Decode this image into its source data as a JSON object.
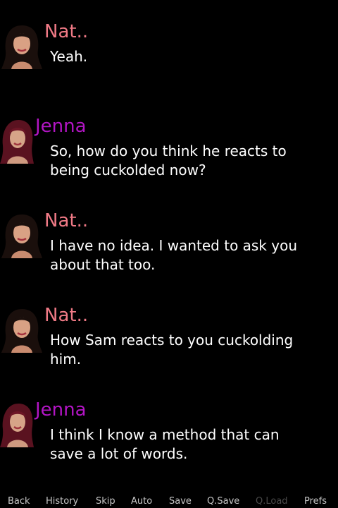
{
  "colors": {
    "nat_name": "#f07a86",
    "jenna_name": "#b215c4",
    "dialogue_text": "#ffffff",
    "menu_text": "#c8c8c8",
    "menu_disabled": "#4a4a4a"
  },
  "history": [
    {
      "speaker": "Nat..",
      "avatar_icon": "nat-portrait-icon",
      "text": "Yeah."
    },
    {
      "speaker": "Jenna",
      "avatar_icon": "jenna-portrait-icon",
      "text": "So, how do you think he reacts to\nbeing cuckolded now?"
    },
    {
      "speaker": "Nat..",
      "avatar_icon": "nat-portrait-icon",
      "text": "I have no idea. I wanted to ask you\nabout that too."
    },
    {
      "speaker": "Nat..",
      "avatar_icon": "nat-portrait-icon",
      "text": "How Sam reacts to you cuckolding\nhim."
    },
    {
      "speaker": "Jenna",
      "avatar_icon": "jenna-portrait-icon",
      "text": "I think I know a method that can\nsave a lot of words."
    }
  ],
  "quick_menu": {
    "back": "Back",
    "history": "History",
    "skip": "Skip",
    "auto": "Auto",
    "save": "Save",
    "qsave": "Q.Save",
    "qload": "Q.Load",
    "prefs": "Prefs"
  }
}
